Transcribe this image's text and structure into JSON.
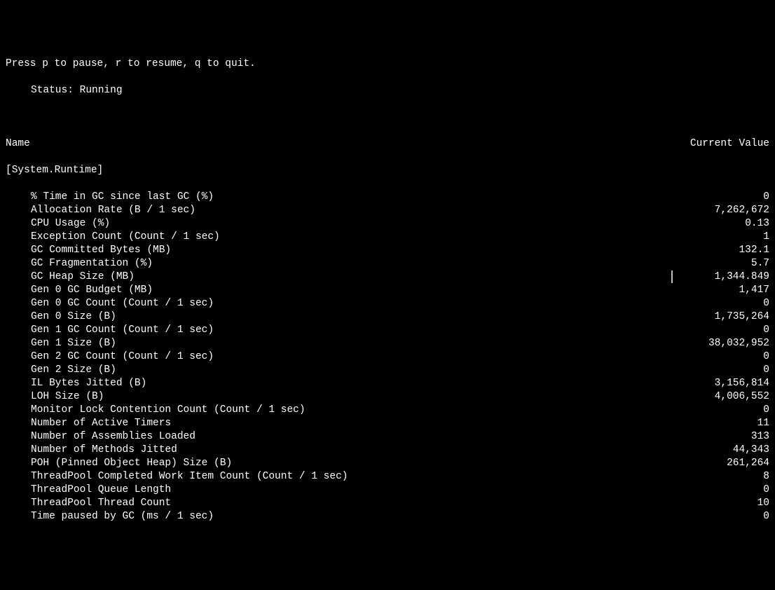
{
  "instruction": "Press p to pause, r to resume, q to quit.",
  "status": {
    "label": "Status:",
    "value": "Running"
  },
  "columns": {
    "name": "Name",
    "value": "Current Value"
  },
  "section": "[System.Runtime]",
  "counters": [
    {
      "name": "% Time in GC since last GC (%)",
      "value": "0"
    },
    {
      "name": "Allocation Rate (B / 1 sec)",
      "value": "7,262,672"
    },
    {
      "name": "CPU Usage (%)",
      "value": "0.13"
    },
    {
      "name": "Exception Count (Count / 1 sec)",
      "value": "1"
    },
    {
      "name": "GC Committed Bytes (MB)",
      "value": "132.1"
    },
    {
      "name": "GC Fragmentation (%)",
      "value": "5.7"
    },
    {
      "name": "GC Heap Size (MB)",
      "value": "1,344.849",
      "cursor": true
    },
    {
      "name": "Gen 0 GC Budget (MB)",
      "value": "1,417"
    },
    {
      "name": "Gen 0 GC Count (Count / 1 sec)",
      "value": "0"
    },
    {
      "name": "Gen 0 Size (B)",
      "value": "1,735,264"
    },
    {
      "name": "Gen 1 GC Count (Count / 1 sec)",
      "value": "0"
    },
    {
      "name": "Gen 1 Size (B)",
      "value": "38,032,952"
    },
    {
      "name": "Gen 2 GC Count (Count / 1 sec)",
      "value": "0"
    },
    {
      "name": "Gen 2 Size (B)",
      "value": "0"
    },
    {
      "name": "IL Bytes Jitted (B)",
      "value": "3,156,814"
    },
    {
      "name": "LOH Size (B)",
      "value": "4,006,552"
    },
    {
      "name": "Monitor Lock Contention Count (Count / 1 sec)",
      "value": "0"
    },
    {
      "name": "Number of Active Timers",
      "value": "11"
    },
    {
      "name": "Number of Assemblies Loaded",
      "value": "313"
    },
    {
      "name": "Number of Methods Jitted",
      "value": "44,343"
    },
    {
      "name": "POH (Pinned Object Heap) Size (B)",
      "value": "261,264"
    },
    {
      "name": "ThreadPool Completed Work Item Count (Count / 1 sec)",
      "value": "8"
    },
    {
      "name": "ThreadPool Queue Length",
      "value": "0"
    },
    {
      "name": "ThreadPool Thread Count",
      "value": "10"
    },
    {
      "name": "Time paused by GC (ms / 1 sec)",
      "value": "0"
    }
  ]
}
